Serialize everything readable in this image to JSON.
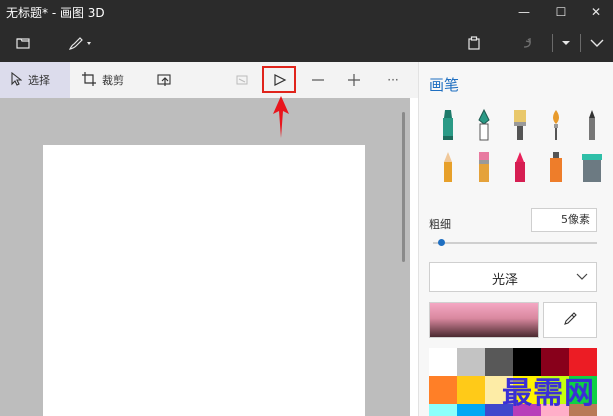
{
  "window": {
    "title": "无标题* - 画图 3D",
    "controls": [
      "minimize",
      "maximize",
      "close"
    ]
  },
  "menubar": {
    "icons": [
      "folder-icon",
      "brush-menu-icon",
      "paste-icon",
      "redo-icon",
      "more-menu-icon",
      "expand-chevron-icon"
    ]
  },
  "toolbar": {
    "select_label": "选择",
    "crop_label": "裁剪",
    "magic_select_icon": "magic-select-icon",
    "more_label": "···"
  },
  "panel": {
    "title": "画笔",
    "thickness_label": "粗细",
    "thickness_value": "5像素",
    "thickness_level": 0.03,
    "texture_option": "光泽",
    "brushes": [
      "marker",
      "calligraphy-pen",
      "oil-brush",
      "watercolor",
      "pixel-pen",
      "pencil",
      "eraser",
      "crayon",
      "spray-can",
      "fill-bucket"
    ],
    "swatch_colors": [
      "#ffffff",
      "#c3c3c3",
      "#585858",
      "#000000",
      "#88001b",
      "#ec1c24",
      "#ff7f27",
      "#ffca18",
      "#fdeca6",
      "#fff200",
      "#c4ff0e",
      "#0ed145",
      "#8cfffb",
      "#00a8f3",
      "#3f48cc",
      "#b83dba",
      "#ffaec8",
      "#b97a57"
    ]
  },
  "accent": {
    "brand_blue": "#1f6fc1",
    "highlight_red": "#e0241b"
  },
  "watermark": "最需网"
}
